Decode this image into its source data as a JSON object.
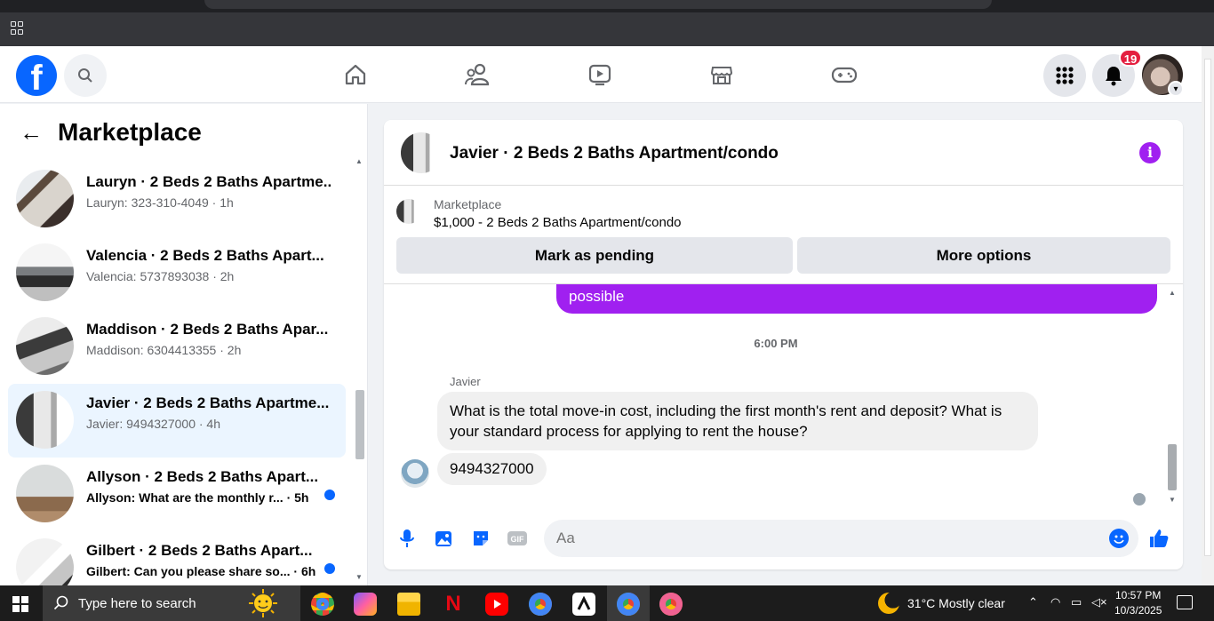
{
  "header": {
    "logo": "f",
    "notification_count": "19"
  },
  "left_panel": {
    "title": "Marketplace",
    "conversations": [
      {
        "name": "Lauryn · 2 Beds 2 Baths Apartme...",
        "sub": "Lauryn: 323-310-4049 · 1h",
        "unread": false,
        "active": false
      },
      {
        "name": "Valencia · 2 Beds 2 Baths Apart...",
        "sub": "Valencia: 5737893038 · 2h",
        "unread": false,
        "active": false
      },
      {
        "name": "Maddison · 2 Beds 2 Baths Apar...",
        "sub": "Maddison: 6304413355 · 2h",
        "unread": false,
        "active": false
      },
      {
        "name": "Javier · 2 Beds 2 Baths Apartme...",
        "sub": "Javier: 9494327000 · 4h",
        "unread": false,
        "active": true
      },
      {
        "name": "Allyson · 2 Beds 2 Baths Apart...",
        "sub": "Allyson: What are the monthly r... · 5h",
        "unread": true,
        "active": false
      },
      {
        "name": "Gilbert · 2 Beds 2 Baths Apart...",
        "sub": "Gilbert: Can you please share so... · 6h",
        "unread": true,
        "active": false
      }
    ]
  },
  "chat": {
    "title": "Javier · 2 Beds 2 Baths Apartment/condo",
    "listing": {
      "kicker": "Marketplace",
      "price_title": "$1,000 - 2 Beds 2 Baths Apartment/condo",
      "mark_pending_label": "Mark as pending",
      "more_options_label": "More options"
    },
    "outgoing_tail": "possible",
    "time_separator": "6:00 PM",
    "sender": "Javier",
    "incoming_1": "What is the total move-in cost, including the first month's rent and deposit? What is your standard process for applying to rent the house?",
    "incoming_2": "9494327000",
    "composer_placeholder": "Aa"
  },
  "taskbar": {
    "search_placeholder": "Type here to search",
    "weather": "31°C  Mostly clear",
    "time": "10:57 PM",
    "date": "10/3/2025"
  },
  "colors": {
    "fb_blue": "#0866ff",
    "accent_purple": "#a020f0",
    "notification_red": "#e41e3f"
  }
}
